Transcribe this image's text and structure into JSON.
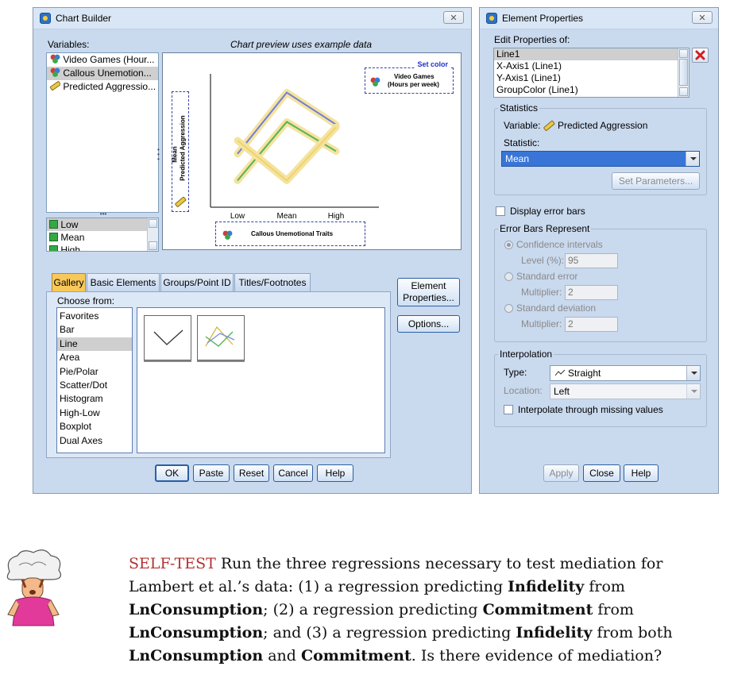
{
  "chart_builder": {
    "title": "Chart Builder",
    "variables_label": "Variables:",
    "preview_note": "Chart preview uses example data",
    "variables": [
      "Video Games (Hour...",
      "Callous Unemotion...",
      "Predicted Aggressio..."
    ],
    "categories_list": [
      "Low",
      "Mean",
      "High"
    ],
    "canvas": {
      "set_color_label": "Set color",
      "color_drop_line1": "Video Games",
      "color_drop_line2": "(Hours per week)",
      "y_drop_stat": "Mean",
      "y_drop_var": "Predicted Aggression",
      "x_drop_label": "Callous Unemotional Traits"
    },
    "tabs": [
      "Gallery",
      "Basic Elements",
      "Groups/Point ID",
      "Titles/Footnotes"
    ],
    "choose_from_label": "Choose from:",
    "chart_types": [
      "Favorites",
      "Bar",
      "Line",
      "Area",
      "Pie/Polar",
      "Scatter/Dot",
      "Histogram",
      "High-Low",
      "Boxplot",
      "Dual Axes"
    ],
    "selected_chart_type": "Line",
    "side_buttons": {
      "element_properties_line1": "Element",
      "element_properties_line2": "Properties...",
      "options": "Options..."
    },
    "bottom_buttons": {
      "ok": "OK",
      "paste": "Paste",
      "reset": "Reset",
      "cancel": "Cancel",
      "help": "Help"
    }
  },
  "chart_data": {
    "type": "line",
    "categories": [
      "Low",
      "Mean",
      "High"
    ],
    "series": [
      {
        "values": [
          2.0,
          4.3,
          3.1
        ],
        "color": "#6f7fd8"
      },
      {
        "values": [
          1.0,
          3.2,
          2.1
        ],
        "color": "#56b356"
      },
      {
        "values": [
          2.5,
          1.0,
          3.0
        ],
        "color": "#f0d36a"
      }
    ],
    "title": "",
    "xlabel": "Callous Unemotional Traits",
    "ylabel": "Predicted Aggression",
    "ylim": [
      0,
      5
    ]
  },
  "element_properties": {
    "title": "Element Properties",
    "edit_label": "Edit Properties of:",
    "edit_items": [
      "Line1",
      "X-Axis1 (Line1)",
      "Y-Axis1 (Line1)",
      "GroupColor (Line1)"
    ],
    "statistics_group": "Statistics",
    "variable_label": "Variable:",
    "variable_value": "Predicted Aggression",
    "statistic_label": "Statistic:",
    "statistic_value": "Mean",
    "set_parameters": "Set Parameters...",
    "display_error_bars": "Display error bars",
    "error_bars_group": "Error Bars Represent",
    "confidence_intervals": "Confidence intervals",
    "level_label": "Level (%):",
    "level_value": "95",
    "standard_error": "Standard error",
    "multiplier_label": "Multiplier:",
    "se_multiplier": "2",
    "standard_deviation": "Standard deviation",
    "sd_multiplier": "2",
    "interpolation_group": "Interpolation",
    "type_label": "Type:",
    "type_value": "Straight",
    "location_label": "Location:",
    "location_value": "Left",
    "interpolate_missing": "Interpolate through missing values",
    "buttons": {
      "apply": "Apply",
      "close": "Close",
      "help": "Help"
    }
  },
  "self_test": {
    "heading": "SELF-TEST",
    "text_1": " Run the three regressions necessary to test mediation for Lambert et al.’s data: (1) a regression predicting ",
    "bold_1": "Infidelity",
    "text_2": " from ",
    "bold_2": "LnConsumption",
    "text_3": "; (2) a regression predicting ",
    "bold_3": "Commitment",
    "text_4": " from ",
    "bold_4": "LnConsumption",
    "text_5": "; and (3) a regression predicting ",
    "bold_5": "Infidelity",
    "text_6": " from both ",
    "bold_6": "LnConsumption",
    "text_7": " and ",
    "bold_7": "Commitment",
    "text_8": ". Is there evidence of mediation?"
  }
}
